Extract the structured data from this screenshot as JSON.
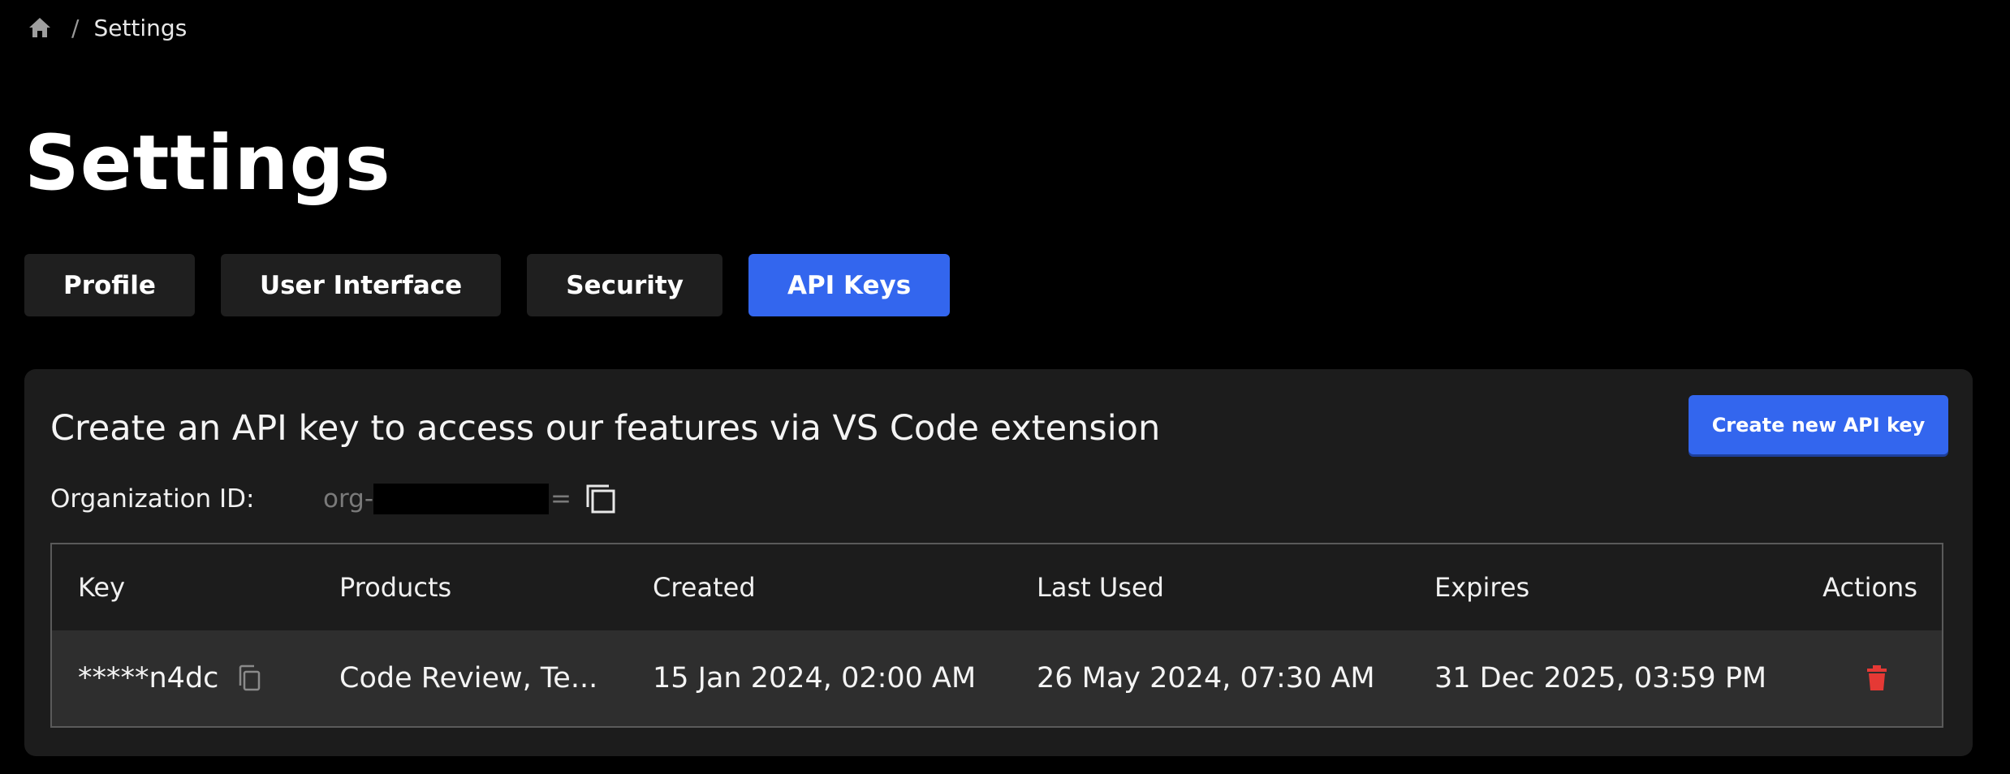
{
  "breadcrumb": {
    "home_icon": "home-icon",
    "separator": "/",
    "current": "Settings"
  },
  "page": {
    "title": "Settings"
  },
  "tabs": [
    {
      "label": "Profile",
      "active": false
    },
    {
      "label": "User Interface",
      "active": false
    },
    {
      "label": "Security",
      "active": false
    },
    {
      "label": "API Keys",
      "active": true
    }
  ],
  "api_keys": {
    "heading": "Create an API key to access our features via VS Code extension",
    "create_button": "Create new API key",
    "org_label": "Organization ID:",
    "org_value_prefix": "org-",
    "org_value_suffix": "=",
    "table": {
      "headers": {
        "key": "Key",
        "products": "Products",
        "created": "Created",
        "last_used": "Last Used",
        "expires": "Expires",
        "actions": "Actions"
      },
      "rows": [
        {
          "key": "*****n4dc",
          "products": "Code Review, Te...",
          "created": "15 Jan 2024, 02:00 AM",
          "last_used": "26 May 2024, 07:30 AM",
          "expires": "31 Dec 2025, 03:59 PM"
        }
      ]
    }
  },
  "colors": {
    "background": "#000000",
    "card": "#1c1c1c",
    "tab": "#1f1f1f",
    "accent": "#3366ee",
    "row": "#2e2e2e",
    "danger": "#e53935"
  }
}
